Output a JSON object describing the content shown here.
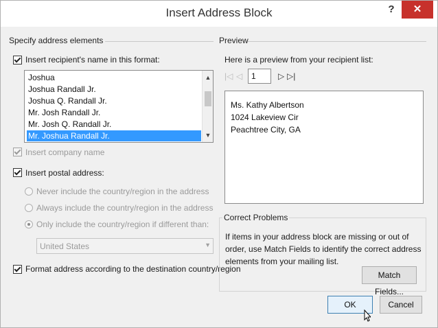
{
  "window": {
    "title": "Insert Address Block",
    "help_label": "?",
    "close_label": "✕"
  },
  "left": {
    "group_title": "Specify address elements",
    "recipient_name": {
      "label": "Insert recipient's name in this format:",
      "checked": true,
      "formats": [
        "Joshua",
        "Joshua Randall Jr.",
        "Joshua Q. Randall Jr.",
        "Mr. Josh Randall Jr.",
        "Mr. Josh Q. Randall Jr.",
        "Mr. Joshua Randall Jr."
      ],
      "selected_index": 5
    },
    "company": {
      "label": "Insert company name",
      "checked": true,
      "disabled": true
    },
    "postal": {
      "label": "Insert postal address:",
      "checked": true,
      "options": [
        "Never include the country/region in the address",
        "Always include the country/region in the address",
        "Only include the country/region if different than:"
      ],
      "selected_option": 2,
      "country": "United States"
    },
    "format_address": {
      "label": "Format address according to the destination country/region",
      "checked": true
    }
  },
  "right": {
    "group_title": "Preview",
    "preview_caption": "Here is a preview from your recipient list:",
    "record": "1",
    "address_lines": [
      "Ms. Kathy Albertson",
      "1024 Lakeview Cir",
      "Peachtree City, GA"
    ],
    "problems_title": "Correct Problems",
    "problems_text": "If items in your address block are missing or out of order, use Match Fields to identify the correct address elements from your mailing list.",
    "match_fields_label": "Match Fields..."
  },
  "footer": {
    "ok_label": "OK",
    "cancel_label": "Cancel"
  },
  "colors": {
    "close_button": "#c7312b",
    "selection": "#3399ff",
    "default_button_border": "#3c7fb1"
  }
}
